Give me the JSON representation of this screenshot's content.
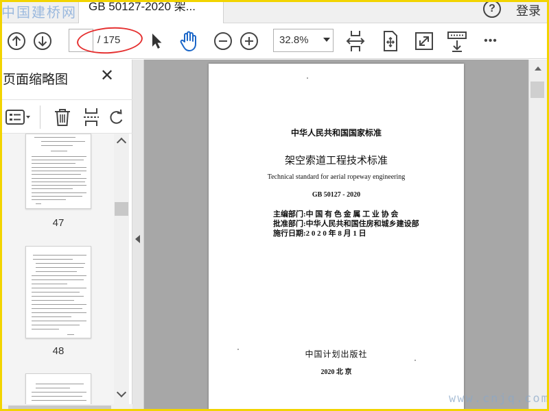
{
  "watermark_top_left": "中国建桥网",
  "watermark_bottom_right": "www.cnjq.com",
  "tab": {
    "title": "GB 50127-2020 架...",
    "close": "×"
  },
  "header": {
    "help": "?",
    "login": "登录"
  },
  "toolbar": {
    "page_total": "/ 175",
    "zoom": "32.8%",
    "more": "•••"
  },
  "sidebar": {
    "title": "页面缩略图",
    "close": "✕",
    "thumbs": [
      {
        "label": "47"
      },
      {
        "label": "48"
      },
      {
        "label": ""
      }
    ]
  },
  "document": {
    "lines": [
      "中华人民共和国国家标准",
      "架空索道工程技术标准",
      "Technical standard for aerial ropeway engineering",
      "GB 50127 - 2020"
    ],
    "info": [
      "主编部门:中 国 有 色 金 属 工 业 协 会",
      "批准部门:中华人民共和国住房和城乡建设部",
      "施行日期:2 0 2 0 年 8 月 1 日"
    ],
    "publisher": "中国计划出版社",
    "pub_year": "2020 北 京"
  },
  "colors": {
    "frame": "#f2d400",
    "annotation": "#e53030",
    "icon_blue": "#1a66c8"
  }
}
